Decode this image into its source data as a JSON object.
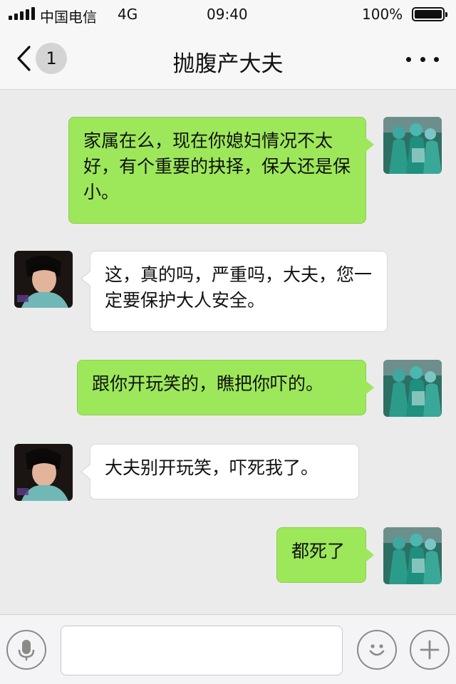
{
  "status_bar": {
    "carrier": "中国电信",
    "network": "4G",
    "time": "09:40",
    "battery_percent": "100%",
    "battery_level": 1.0
  },
  "nav": {
    "back_icon": "chevron-left-icon",
    "unread_count": "1",
    "title": "抛腹产大夫",
    "more_icon": "more-dots-icon"
  },
  "messages": [
    {
      "side": "right",
      "text": "家属在么，现在你媳妇情况不太好，有个重要的抉择，保大还是保小。"
    },
    {
      "side": "left",
      "text": "这，真的吗，严重吗，大夫，您一定要保护大人安全。"
    },
    {
      "side": "right",
      "text": "跟你开玩笑的，瞧把你吓的。"
    },
    {
      "side": "left",
      "text": "大夫别开玩笑，吓死我了。"
    },
    {
      "side": "right",
      "text": "都死了"
    }
  ],
  "input_bar": {
    "voice_icon": "microphone-icon",
    "text_value": "",
    "emoji_icon": "smiley-icon",
    "plus_icon": "plus-icon"
  },
  "colors": {
    "sent_bubble": "#9de85a",
    "received_bubble": "#ffffff",
    "background": "#ebebeb"
  }
}
